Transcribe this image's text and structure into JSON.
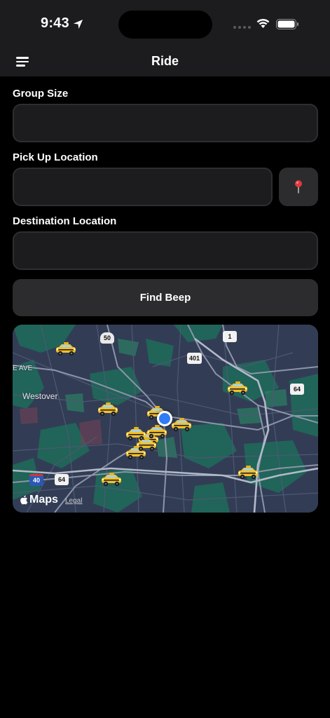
{
  "status_bar": {
    "time": "9:43"
  },
  "nav": {
    "title": "Ride",
    "menu_icon": "hamburger-menu-icon"
  },
  "form": {
    "group_size": {
      "label": "Group Size",
      "value": "",
      "placeholder": ""
    },
    "pickup": {
      "label": "Pick Up Location",
      "value": "",
      "placeholder": "",
      "pin_icon": "round-pushpin-icon"
    },
    "destination": {
      "label": "Destination Location",
      "value": "",
      "placeholder": ""
    },
    "find_button": "Find Beep"
  },
  "map": {
    "place_labels": [
      "Westover",
      "E AVE"
    ],
    "road_shields": [
      "50",
      "1",
      "401",
      "64",
      "40",
      "64"
    ],
    "attribution": "Maps",
    "legal": "Legal",
    "taxi_count": 12
  },
  "colors": {
    "background": "#000000",
    "surface": "#1c1c1e",
    "button": "#2c2c2e",
    "user_location": "#2f7cf6",
    "taxi": "#f5c02a"
  }
}
